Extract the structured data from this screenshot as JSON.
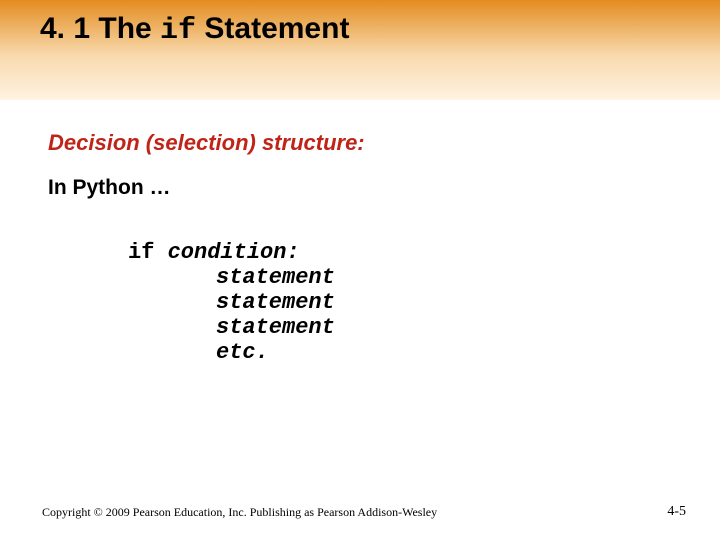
{
  "title": {
    "prefix": "4. 1 The ",
    "mono": "if",
    "suffix": " Statement"
  },
  "subheading": "Decision (selection) structure:",
  "label": "In Python …",
  "code": {
    "line1_kw": "if ",
    "line1_cond": "condition:",
    "stmt": "statement",
    "etc": "etc."
  },
  "footer": {
    "copyright": "Copyright © 2009 Pearson Education, Inc. Publishing as Pearson Addison-Wesley",
    "page": "4-5"
  }
}
